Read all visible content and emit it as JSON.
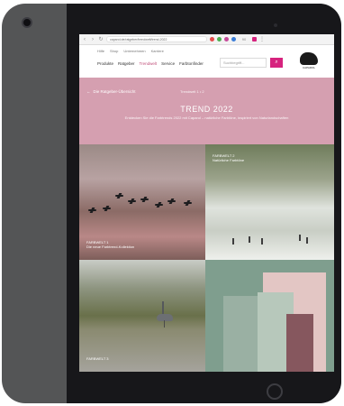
{
  "browser": {
    "url": "caparol.de/ratgeber/trendwelt/trend-2022",
    "zoom": "90"
  },
  "site": {
    "topnav": [
      "Hilfe",
      "Shop",
      "Unternehmen",
      "Karriere"
    ],
    "mainnav": [
      "Produkte",
      "Ratgeber",
      "Trendwelt",
      "Service",
      "Farbtonfinder"
    ],
    "active_nav_index": 2,
    "search_placeholder": "Suchbegriff...",
    "logo_caption": "CAPAROL"
  },
  "hero": {
    "back_label": "Die Ratgeber-Übersicht",
    "breadcrumb": "Trendwelt 1 • 2",
    "title": "TREND 2022",
    "subtitle": "Entdecken Sie die Farbtrends 2022 mit Caparol – natürliche Farbtöne, inspiriert von Naturlandschaften"
  },
  "tiles": [
    {
      "label": "FARBWELT 1",
      "sublabel": "Die neue Farbtrend-Kollektion"
    },
    {
      "label": "FARBWELT 2",
      "sublabel": "Natürliche Farbtöne"
    },
    {
      "label": "FARBWELT 3",
      "sublabel": ""
    },
    {
      "label": "",
      "sublabel": ""
    }
  ],
  "colors": {
    "hero_pink": "#d59fb0",
    "accent_pink": "#d6237e",
    "device_gray": "#545556"
  }
}
